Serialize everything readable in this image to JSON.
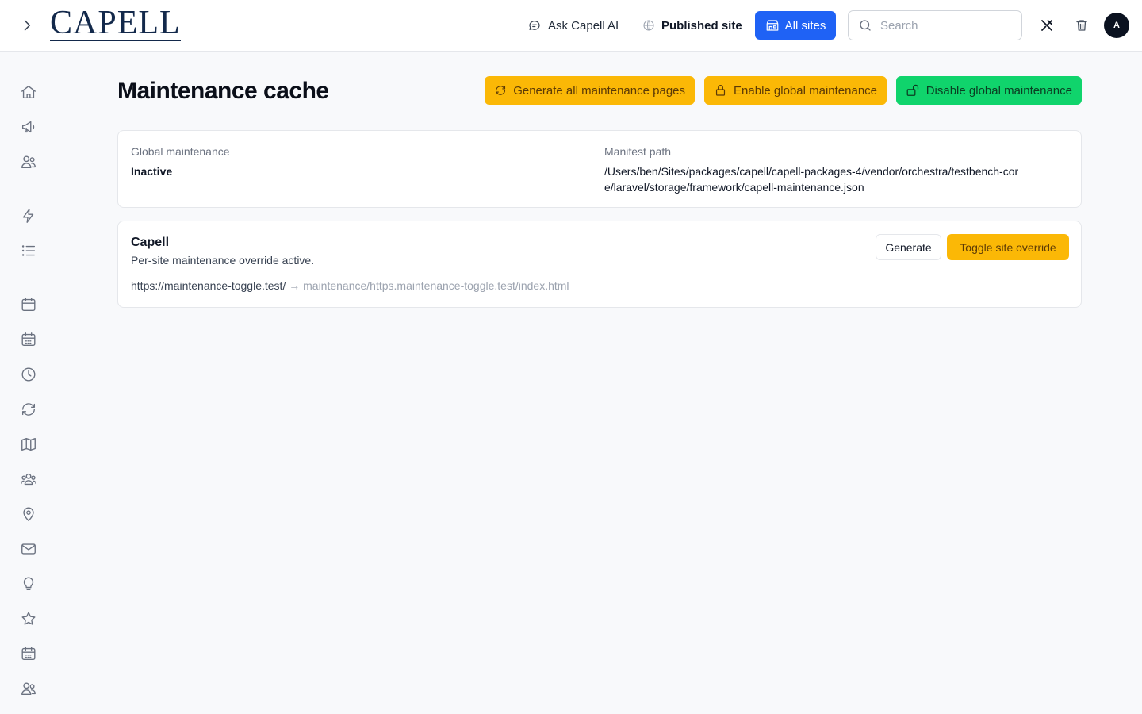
{
  "header": {
    "logo": "CAPELL",
    "ask_ai": "Ask Capell AI",
    "published_site": "Published site",
    "all_sites": "All sites",
    "search_placeholder": "Search",
    "avatar_initial": "A"
  },
  "sidebar": {
    "icons": [
      "home-icon",
      "megaphone-icon",
      "users-icon",
      "bolt-icon",
      "list-icon",
      "calendar-icon",
      "calendar-days-icon",
      "clock-icon",
      "refresh-icon",
      "map-icon",
      "user-group-icon",
      "map-pin-icon",
      "envelope-icon",
      "lightbulb-icon",
      "star-icon",
      "calendar-days-icon",
      "users-icon"
    ]
  },
  "page": {
    "title": "Maintenance cache",
    "actions": {
      "generate_all": "Generate all maintenance pages",
      "enable_global": "Enable global maintenance",
      "disable_global": "Disable global maintenance"
    }
  },
  "status_card": {
    "global_label": "Global maintenance",
    "global_value": "Inactive",
    "manifest_label": "Manifest path",
    "manifest_line1": "/Users/ben/Sites/packages/capell/capell-packages-4/vendor/orchestra/testbench-cor",
    "manifest_line2": "e/laravel/storage/framework/capell-maintenance.json"
  },
  "site_card": {
    "name": "Capell",
    "status": "Per-site maintenance override active.",
    "url": "https://maintenance-toggle.test/",
    "arrow": "→",
    "path": "maintenance/https.maintenance-toggle.test/index.html",
    "generate_label": "Generate",
    "toggle_label": "Toggle site override"
  },
  "colors": {
    "primary": "#1f62f5",
    "amber": "#fbb806",
    "green": "#10d46c"
  }
}
